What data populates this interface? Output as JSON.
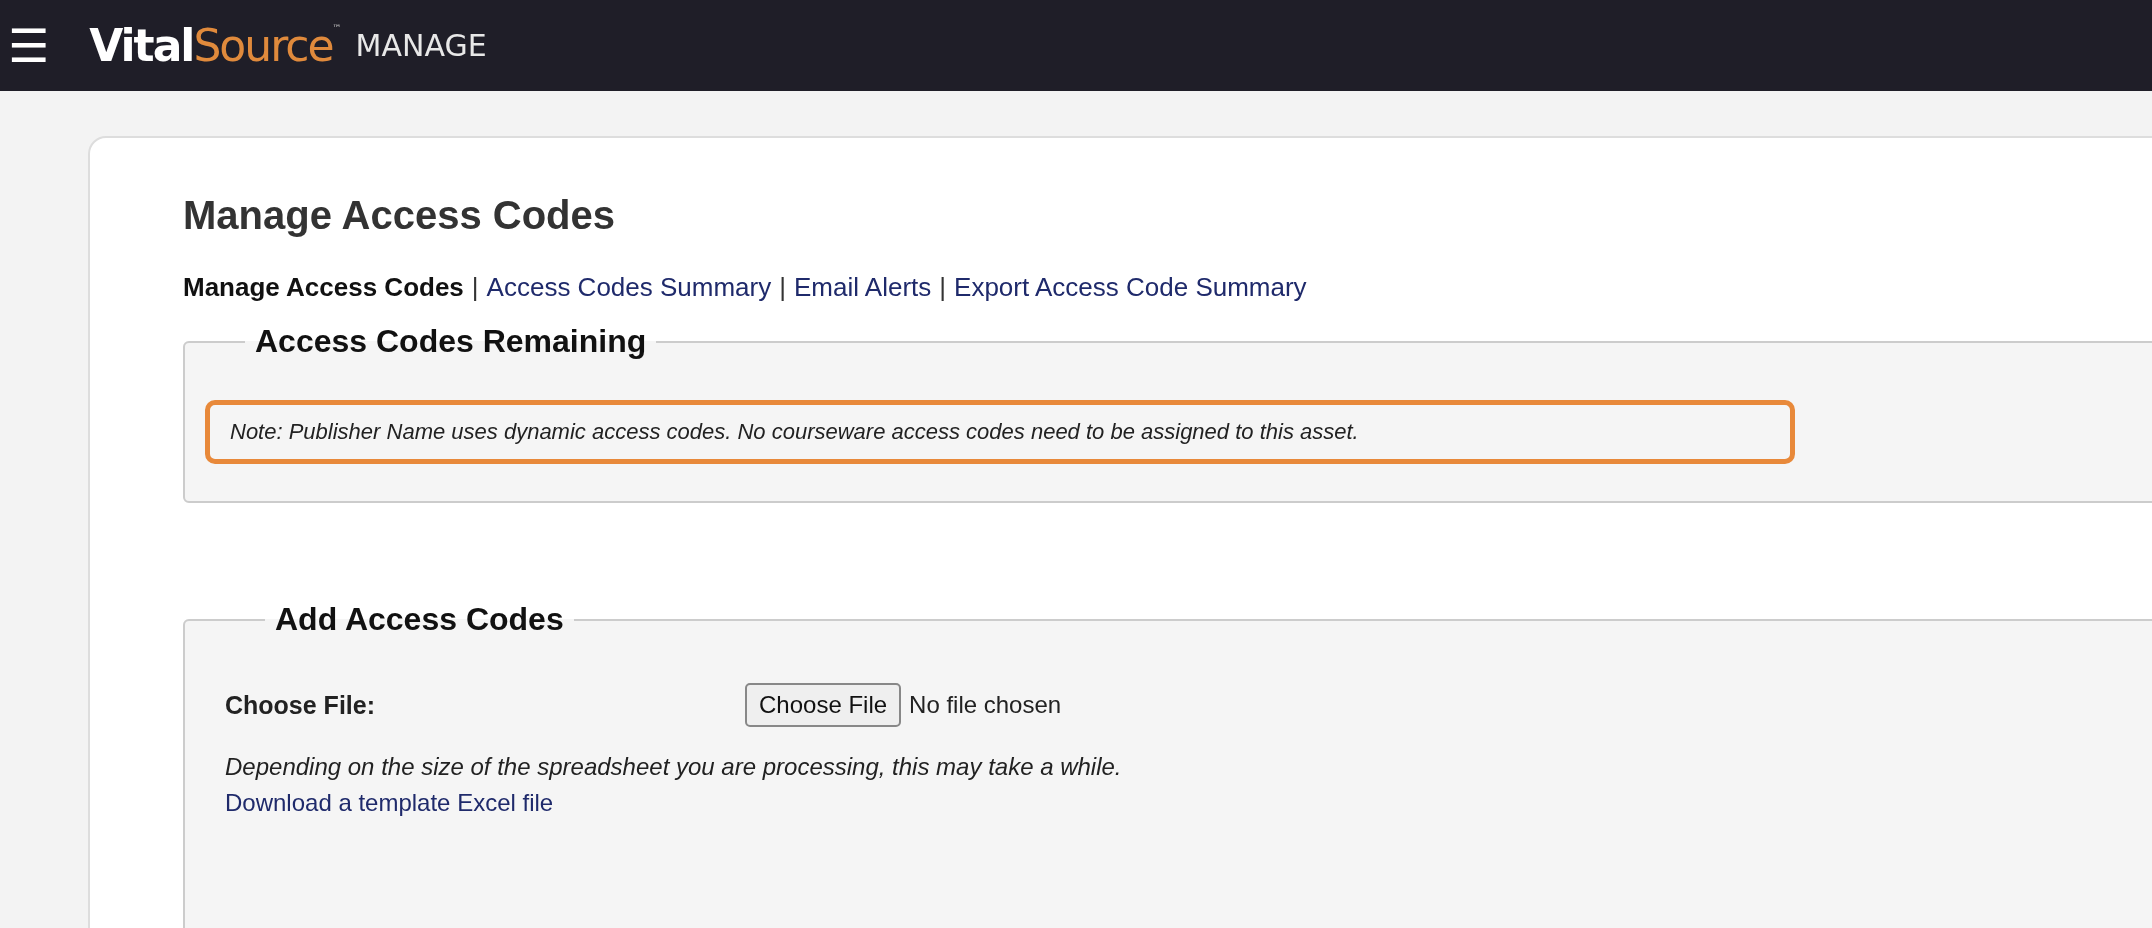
{
  "header": {
    "menu_icon": "☰",
    "logo": {
      "first": "Vital",
      "second": "Source",
      "mark": "™"
    },
    "app_name": "MANAGE"
  },
  "page": {
    "title": "Manage Access Codes",
    "nav": {
      "separator": "|",
      "items": [
        {
          "label": "Manage Access Codes",
          "selected": true
        },
        {
          "label": "Access Codes Summary",
          "selected": false
        },
        {
          "label": "Email Alerts",
          "selected": false
        },
        {
          "label": "Export Access Code Summary",
          "selected": false
        }
      ]
    },
    "remaining": {
      "legend": "Access Codes Remaining",
      "note": "Note: Publisher Name uses dynamic access codes. No courseware access codes need to be assigned to this asset.",
      "note_highlighted": true
    },
    "add": {
      "legend": "Add Access Codes",
      "file_label": "Choose File:",
      "file_button": "Choose File",
      "file_status": "No file chosen",
      "hint": "Depending on the size of the spreadsheet you are processing, this may take a while.",
      "template_link": "Download a template Excel file"
    }
  }
}
